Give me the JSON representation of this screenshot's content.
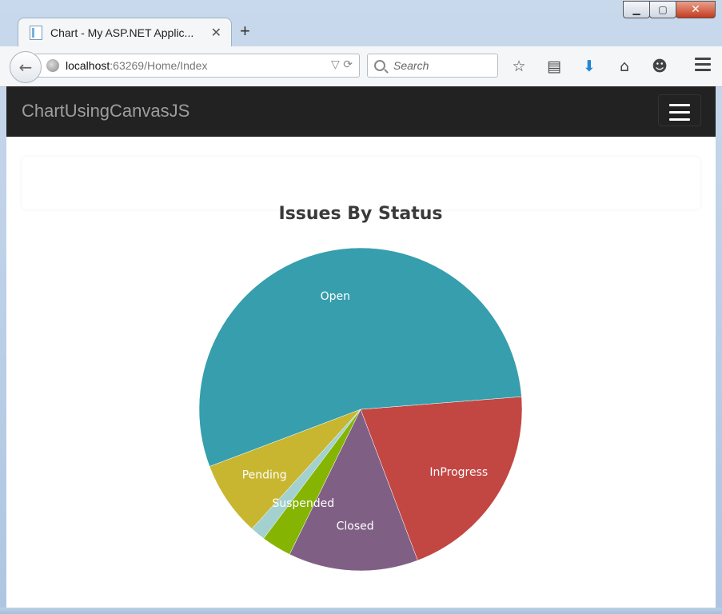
{
  "browser": {
    "tab": {
      "title": "Chart - My ASP.NET Applic...",
      "close": "✕"
    },
    "new_tab": "+",
    "url": {
      "host": "localhost",
      "path": ":63269/Home/Index"
    },
    "search_placeholder": "Search"
  },
  "site": {
    "brand": "ChartUsingCanvasJS"
  },
  "chart_data": {
    "type": "pie",
    "title": "Issues By Status",
    "start_angle_deg": -4.5,
    "slices": [
      {
        "label": "InProgress",
        "value": 20.5,
        "color": "#C24642"
      },
      {
        "label": "Closed",
        "value": 13,
        "color": "#7F6084"
      },
      {
        "label": "Suspended",
        "value": 3,
        "color": "#86B402"
      },
      {
        "label": "",
        "value": 1.5,
        "color": "#A2D1CF"
      },
      {
        "label": "Pending",
        "value": 7.5,
        "color": "#C8B631"
      },
      {
        "label": "Open",
        "value": 54.5,
        "color": "#369EAD"
      }
    ]
  }
}
